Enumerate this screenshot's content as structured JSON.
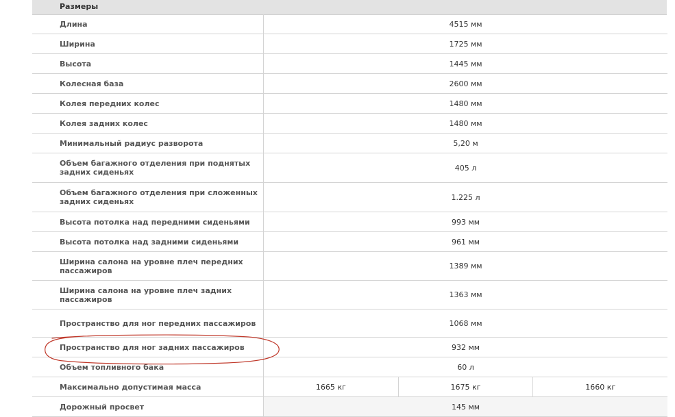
{
  "section_title": "Размеры",
  "rows": [
    {
      "label": "Длина",
      "value": "4515 мм"
    },
    {
      "label": "Ширина",
      "value": "1725 мм"
    },
    {
      "label": "Высота",
      "value": "1445 мм"
    },
    {
      "label": "Колесная база",
      "value": "2600 мм"
    },
    {
      "label": "Колея передних колес",
      "value": "1480 мм"
    },
    {
      "label": "Колея задних колес",
      "value": "1480 мм"
    },
    {
      "label": "Минимальный радиус разворота",
      "value": "5,20 м"
    },
    {
      "label": "Объем багажного отделения при поднятых задних сиденьях",
      "value": "405 л"
    },
    {
      "label": "Объем багажного отделения при сложенных задних сиденьях",
      "value": "1.225 л"
    },
    {
      "label": "Высота потолка над передними сиденьями",
      "value": "993 мм"
    },
    {
      "label": "Высота потолка над задними сиденьями",
      "value": "961 мм"
    },
    {
      "label": "Ширина салона на уровне плеч передних пассажиров",
      "value": "1389 мм"
    },
    {
      "label": "Ширина салона на уровне плеч задних пассажиров",
      "value": "1363 мм"
    },
    {
      "label": "Пространство для ног передних пассажиров",
      "value": "1068 мм"
    },
    {
      "label": "Пространство для ног задних пассажиров",
      "value": "932 мм"
    },
    {
      "label": "Объем топливного бака",
      "value": "60 л"
    },
    {
      "label": "Максимально допустимая масса",
      "values": [
        "1665 кг",
        "1675 кг",
        "1660 кг"
      ]
    },
    {
      "label": "Дорожный просвет",
      "value": "145 мм"
    }
  ],
  "annotation": {
    "color": "#c0392b",
    "circled_row": "Пространство для ног задних пассажиров"
  }
}
